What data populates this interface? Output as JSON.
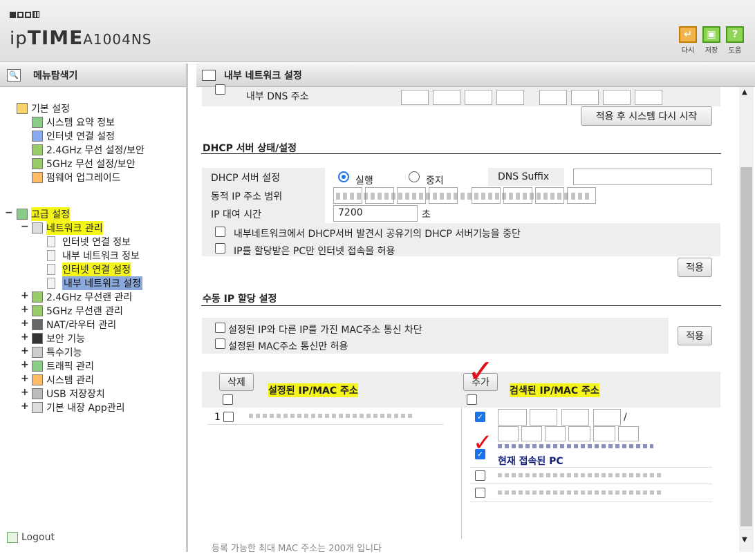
{
  "header": {
    "brand_ip": "ip",
    "brand_time": "TIME",
    "brand_model": "A1004NS",
    "toolbar": [
      {
        "label": "다시",
        "icon": "refresh-icon",
        "color": "#e8a21c"
      },
      {
        "label": "저장",
        "icon": "save-icon",
        "color": "#6cbf2a"
      },
      {
        "label": "도움",
        "icon": "help-icon",
        "color": "#6cbf2a"
      }
    ]
  },
  "left": {
    "title": "메뉴탐색기",
    "logout": "Logout",
    "basic": "기본 설정",
    "basic_items": [
      "시스템 요약 정보",
      "인터넷 연결 설정",
      "2.4GHz 무선 설정/보안",
      "5GHz 무선 설정/보안",
      "펌웨어 업그레이드"
    ],
    "advanced": "고급 설정",
    "network": "네트워크 관리",
    "network_items": [
      "인터넷 연결 정보",
      "내부 네트워크 정보",
      "인터넷 연결 설정",
      "내부 네트워크 설정"
    ],
    "adv_items": [
      "2.4GHz 무선랜 관리",
      "5GHz 무선랜 관리",
      "NAT/라우터 관리",
      "보안 기능",
      "특수기능",
      "트래픽 관리",
      "시스템 관리",
      "USB 저장장치",
      "기본 내장 App관리"
    ]
  },
  "right": {
    "title": "내부 네트워크 설정",
    "dns_label": "내부 DNS 주소",
    "apply_restart": "적용 후 시스템 다시 시작",
    "dhcp_title": "DHCP 서버 상태/설정",
    "dhcp_server": "DHCP 서버 설정",
    "run": "실행",
    "stop": "중지",
    "dns_suffix": "DNS Suffix",
    "range": "동적 IP 주소 범위",
    "lease": "IP 대여 시간",
    "lease_value": "7200",
    "lease_unit": "초",
    "opt1": "내부네트워크에서 DHCP서버 발견시 공유기의 DHCP 서버기능을 중단",
    "opt2": "IP를 할당받은 PC만 인터넷 접속을 허용",
    "apply": "적용",
    "manual_title": "수동 IP 할당 설정",
    "block1": "설정된 IP와 다른 IP를 가진 MAC주소 통신 차단",
    "block2": "설정된 MAC주소 통신만 허용",
    "delete": "삭제",
    "add": "추가",
    "configured": "설정된 IP/MAC 주소",
    "found": "검색된 IP/MAC 주소",
    "row_num": "1",
    "connected_pc": "현재 접속된 PC",
    "footer": "등록 가능한 최대 MAC 주소는 200개 입니다"
  }
}
